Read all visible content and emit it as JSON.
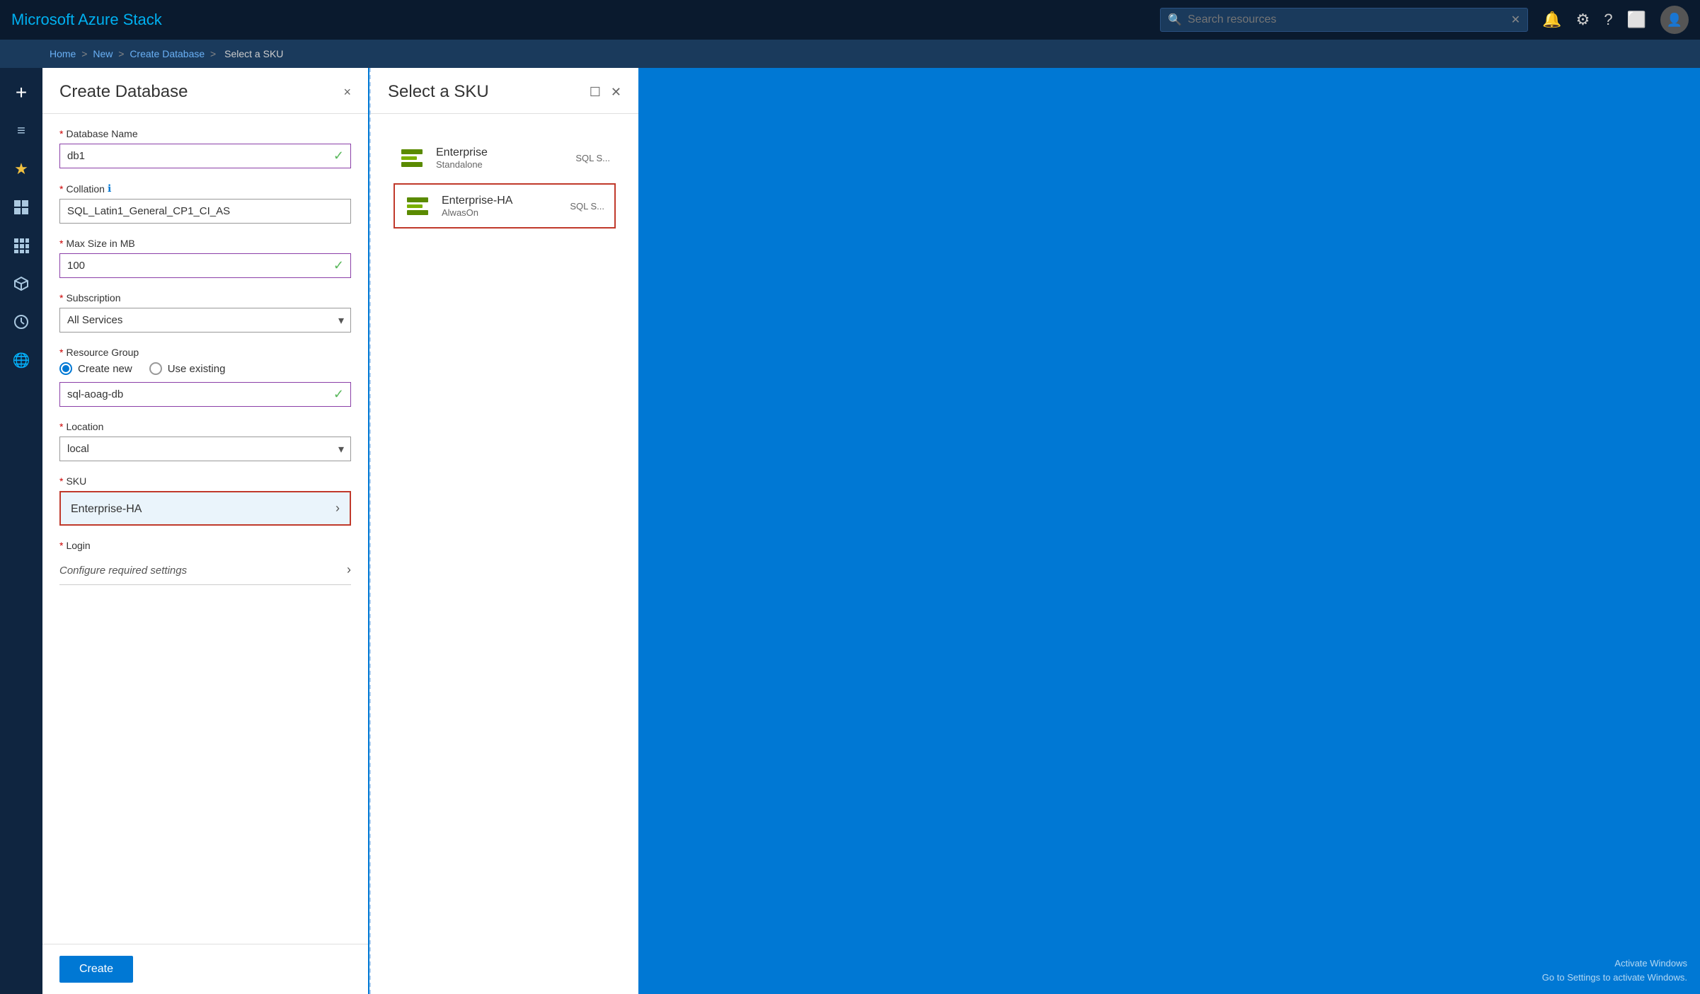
{
  "app": {
    "title": "Microsoft Azure Stack"
  },
  "topbar": {
    "search_placeholder": "Search resources",
    "close_icon": "✕"
  },
  "breadcrumb": {
    "items": [
      "Home",
      "New",
      "Create Database",
      "Select a SKU"
    ],
    "separators": [
      ">",
      ">",
      ">"
    ]
  },
  "sidebar": {
    "icons": [
      {
        "name": "plus-icon",
        "symbol": "+",
        "label": "New"
      },
      {
        "name": "menu-icon",
        "symbol": "≡",
        "label": "Menu"
      },
      {
        "name": "star-icon",
        "symbol": "★",
        "label": "Favorites"
      },
      {
        "name": "dashboard-icon",
        "symbol": "⊞",
        "label": "Dashboard"
      },
      {
        "name": "grid-icon",
        "symbol": "▦",
        "label": "All resources"
      },
      {
        "name": "box-icon",
        "symbol": "◈",
        "label": "Resource groups"
      },
      {
        "name": "clock-icon",
        "symbol": "⏱",
        "label": "Recent"
      },
      {
        "name": "globe-icon",
        "symbol": "🌐",
        "label": "More services"
      }
    ]
  },
  "create_panel": {
    "title": "Create Database",
    "close_label": "×",
    "fields": {
      "database_name": {
        "label": "Database Name",
        "value": "db1",
        "required": true
      },
      "collation": {
        "label": "Collation",
        "info": true,
        "value": "SQL_Latin1_General_CP1_CI_AS",
        "required": true
      },
      "max_size": {
        "label": "Max Size in MB",
        "value": "100",
        "required": true
      },
      "subscription": {
        "label": "Subscription",
        "value": "All Services",
        "required": true,
        "options": [
          "All Services"
        ]
      },
      "resource_group": {
        "label": "Resource Group",
        "required": true,
        "create_new_label": "Create new",
        "use_existing_label": "Use existing",
        "value": "sql-aoag-db"
      },
      "location": {
        "label": "Location",
        "value": "local",
        "required": true,
        "options": [
          "local"
        ]
      },
      "sku": {
        "label": "SKU",
        "value": "Enterprise-HA",
        "required": true
      },
      "login": {
        "label": "Login",
        "value": "Configure required settings",
        "required": true
      }
    },
    "create_button": "Create"
  },
  "sku_panel": {
    "title": "Select a SKU",
    "items": [
      {
        "name": "Enterprise",
        "subtitle": "Standalone",
        "type": "SQL S...",
        "selected": false
      },
      {
        "name": "Enterprise-HA",
        "subtitle": "AlwasOn",
        "type": "SQL S...",
        "selected": true
      }
    ]
  },
  "watermark": {
    "line1": "Activate Windows",
    "line2": "Go to Settings to activate Windows."
  }
}
